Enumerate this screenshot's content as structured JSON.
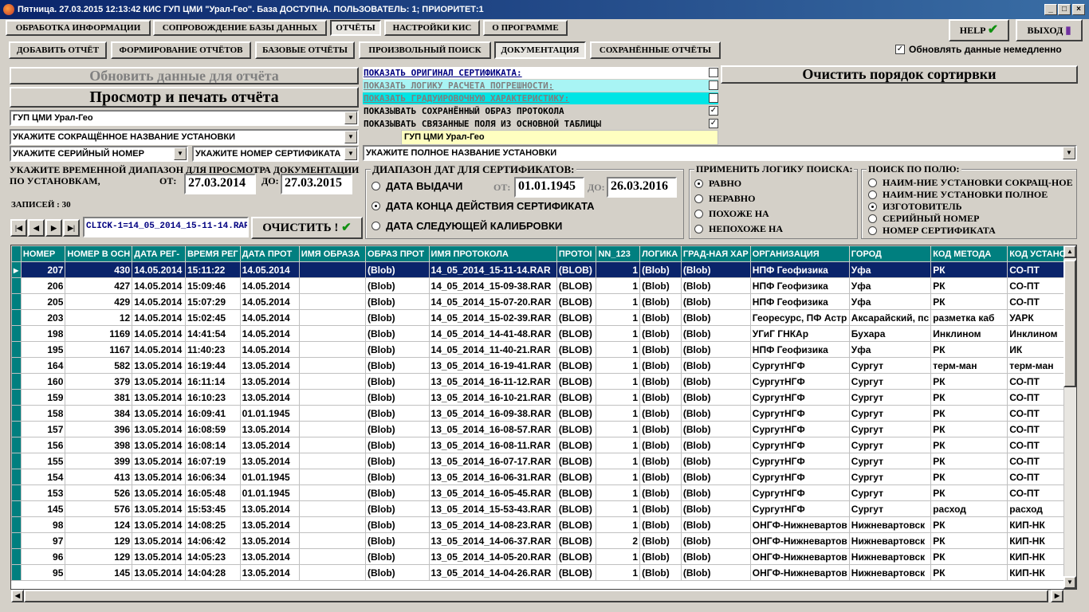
{
  "window": {
    "title": "Пятница. 27.03.2015 12:13:42 КИС ГУП ЦМИ \"Урал-Гео\". База ДОСТУПНА. ПОЛЬЗОВАТЕЛЬ: 1; ПРИОРИТЕТ:1"
  },
  "main_tabs": [
    "ОБРАБОТКА ИНФОРМАЦИИ",
    "СОПРОВОЖДЕНИЕ БАЗЫ ДАННЫХ",
    "ОТЧЁТЫ",
    "НАСТРОЙКИ КИС",
    "О ПРОГРАММЕ"
  ],
  "sub_tabs": [
    "ДОБАВИТЬ ОТЧЁТ",
    "ФОРМИРОВАНИЕ ОТЧЁТОВ",
    "БАЗОВЫЕ ОТЧЁТЫ",
    "ПРОИЗВОЛЬНЫЙ ПОИСК",
    "ДОКУМЕНТАЦИЯ",
    "СОХРАНЁННЫЕ ОТЧЁТЫ"
  ],
  "help_label": "HELP",
  "exit_label": "ВЫХОД",
  "auto_update": {
    "label": "Обновлять данные немедленно",
    "checked": true
  },
  "refresh_btn": "Обновить данные для отчёта",
  "print_btn": "Просмотр и печать отчёта",
  "clear_sort_btn": "Очистить порядок сортирвки",
  "org_combo": "ГУП ЦМИ Урал-Гео",
  "short_name_combo": "УКАЖИТЕ СОКРАЩЁННОЕ НАЗВАНИЕ УСТАНОВКИ",
  "serial_combo": "УКАЖИТЕ СЕРИЙНЫЙ НОМЕР",
  "cert_combo": "УКАЖИТЕ НОМЕР СЕРТИФИКАТА",
  "full_name_combo": "УКАЖИТЕ ПОЛНОЕ НАЗВАНИЕ УСТАНОВКИ",
  "org_display": "ГУП ЦМИ Урал-Гео",
  "options": [
    {
      "label": "ПОКАЗАТЬ ОРИГИНАЛ СЕРТИФИКАТА:",
      "checked": false,
      "bg": "#ffffff",
      "color": "#000080"
    },
    {
      "label": "ПОКАЗАТЬ ЛОГИКУ РАСЧЕТА ПОГРЕШНОСТИ:",
      "checked": false,
      "bg": "#a8f4f4",
      "color": "#7f7f7f"
    },
    {
      "label": "ПОКАЗАТЬ ГРАДУИРОВОЧНУЮ ХАРАКТЕРИСТИКУ:",
      "checked": false,
      "bg": "#00e5e5",
      "color": "#7f7f7f"
    },
    {
      "label": "ПОКАЗЫВАТЬ СОХРАНЁННЫЙ ОБРАЗ ПРОТОКОЛА",
      "checked": true,
      "bg": "#d4d0c8",
      "color": "#000000"
    },
    {
      "label": "ПОКАЗЫВАТЬ СВЯЗАННЫЕ ПОЛЯ ИЗ ОСНОВНОЙ ТАБЛИЦЫ",
      "checked": true,
      "bg": "#d4d0c8",
      "color": "#000000"
    }
  ],
  "range_label_1": "УКАЖИТЕ ВРЕМЕННОЙ ДИАПАЗОН ДЛЯ ПРОСМОТРА ДОКУМЕНТАЦИИ",
  "range_label_2": "ПО УСТАНОВКАМ,",
  "from_label": "ОТ:",
  "to_label": "ДО:",
  "date_from": "27.03.2014",
  "date_to": "27.03.2015",
  "records_label": "ЗАПИСЕЙ : 30",
  "filter_text": "CLICK-1=14_05_2014_15-11-14.RAR",
  "clear_btn": "ОЧИСТИТЬ !",
  "cert_range": {
    "title": "ДИАПАЗОН ДАТ ДЛЯ СЕРТИФИКАТОВ:",
    "options": [
      "ДАТА ВЫДАЧИ",
      "ДАТА КОНЦА ДЕЙСТВИЯ СЕРТИФИКАТА",
      "ДАТА СЛЕДУЮЩЕЙ КАЛИБРОВКИ"
    ],
    "selected": 1,
    "from_label": "ОТ:",
    "to_label": "ДО:",
    "from": "01.01.1945",
    "to": "26.03.2016"
  },
  "logic": {
    "title": "ПРИМЕНИТЬ ЛОГИКУ ПОИСКА:",
    "options": [
      "РАВНО",
      "НЕРАВНО",
      "ПОХОЖЕ НА",
      "НЕПОХОЖЕ НА"
    ],
    "selected": 0
  },
  "field": {
    "title": "ПОИСК ПО ПОЛЮ:",
    "options": [
      "НАИМ-НИЕ УСТАНОВКИ СОКРАЩ-НОЕ",
      "НАИМ-НИЕ УСТАНОВКИ ПОЛНОЕ",
      "ИЗГОТОВИТЕЛЬ",
      "СЕРИЙНЫЙ НОМЕР",
      "НОМЕР СЕРТИФИКАТА"
    ],
    "selected": 2
  },
  "nav_icons": [
    "first-record-icon",
    "prev-record-icon",
    "next-record-icon",
    "last-record-icon"
  ],
  "table": {
    "headers": [
      "НОМЕР",
      "НОМЕР В ОСН",
      "ДАТА РЕГ-",
      "ВРЕМЯ РЕГ",
      "ДАТА ПРОТ",
      "ИМЯ ОБРАЗА",
      "ОБРАЗ ПРОТ",
      "ИМЯ ПРОТОКОЛА",
      "ПРОТОІ",
      "NN_123",
      "ЛОГИКА",
      "ГРАД-НАЯ ХАР",
      "ОРГАНИЗАЦИЯ",
      "ГОРОД",
      "КОД МЕТОДА",
      "КОД УСТАНОВ"
    ],
    "rows": [
      [
        "207",
        "430",
        "14.05.2014",
        "15:11:22",
        "14.05.2014",
        "",
        "(Blob)",
        "14_05_2014_15-11-14.RAR",
        "(BLOB)",
        "1",
        "(Blob)",
        "(Blob)",
        "НПФ Геофизика",
        "Уфа",
        "РК",
        "СО-ПТ"
      ],
      [
        "206",
        "427",
        "14.05.2014",
        "15:09:46",
        "14.05.2014",
        "",
        "(Blob)",
        "14_05_2014_15-09-38.RAR",
        "(BLOB)",
        "1",
        "(Blob)",
        "(Blob)",
        "НПФ Геофизика",
        "Уфа",
        "РК",
        "СО-ПТ"
      ],
      [
        "205",
        "429",
        "14.05.2014",
        "15:07:29",
        "14.05.2014",
        "",
        "(Blob)",
        "14_05_2014_15-07-20.RAR",
        "(BLOB)",
        "1",
        "(Blob)",
        "(Blob)",
        "НПФ Геофизика",
        "Уфа",
        "РК",
        "СО-ПТ"
      ],
      [
        "203",
        "12",
        "14.05.2014",
        "15:02:45",
        "14.05.2014",
        "",
        "(Blob)",
        "14_05_2014_15-02-39.RAR",
        "(BLOB)",
        "1",
        "(Blob)",
        "(Blob)",
        "Георесурс, ПФ Астр",
        "Аксарайский, пс",
        "разметка каб",
        "УАРК"
      ],
      [
        "198",
        "1169",
        "14.05.2014",
        "14:41:54",
        "14.05.2014",
        "",
        "(Blob)",
        "14_05_2014_14-41-48.RAR",
        "(BLOB)",
        "1",
        "(Blob)",
        "(Blob)",
        "УГиГ ГНКАр",
        "Бухара",
        "Инклином",
        "Инклином"
      ],
      [
        "195",
        "1167",
        "14.05.2014",
        "11:40:23",
        "14.05.2014",
        "",
        "(Blob)",
        "14_05_2014_11-40-21.RAR",
        "(BLOB)",
        "1",
        "(Blob)",
        "(Blob)",
        "НПФ Геофизика",
        "Уфа",
        "РК",
        "ИК"
      ],
      [
        "164",
        "582",
        "13.05.2014",
        "16:19:44",
        "13.05.2014",
        "",
        "(Blob)",
        "13_05_2014_16-19-41.RAR",
        "(BLOB)",
        "1",
        "(Blob)",
        "(Blob)",
        "СургутНГФ",
        "Сургут",
        "терм-ман",
        "терм-ман"
      ],
      [
        "160",
        "379",
        "13.05.2014",
        "16:11:14",
        "13.05.2014",
        "",
        "(Blob)",
        "13_05_2014_16-11-12.RAR",
        "(BLOB)",
        "1",
        "(Blob)",
        "(Blob)",
        "СургутНГФ",
        "Сургут",
        "РК",
        "СО-ПТ"
      ],
      [
        "159",
        "381",
        "13.05.2014",
        "16:10:23",
        "13.05.2014",
        "",
        "(Blob)",
        "13_05_2014_16-10-21.RAR",
        "(BLOB)",
        "1",
        "(Blob)",
        "(Blob)",
        "СургутНГФ",
        "Сургут",
        "РК",
        "СО-ПТ"
      ],
      [
        "158",
        "384",
        "13.05.2014",
        "16:09:41",
        "01.01.1945",
        "",
        "(Blob)",
        "13_05_2014_16-09-38.RAR",
        "(BLOB)",
        "1",
        "(Blob)",
        "(Blob)",
        "СургутНГФ",
        "Сургут",
        "РК",
        "СО-ПТ"
      ],
      [
        "157",
        "396",
        "13.05.2014",
        "16:08:59",
        "13.05.2014",
        "",
        "(Blob)",
        "13_05_2014_16-08-57.RAR",
        "(BLOB)",
        "1",
        "(Blob)",
        "(Blob)",
        "СургутНГФ",
        "Сургут",
        "РК",
        "СО-ПТ"
      ],
      [
        "156",
        "398",
        "13.05.2014",
        "16:08:14",
        "13.05.2014",
        "",
        "(Blob)",
        "13_05_2014_16-08-11.RAR",
        "(BLOB)",
        "1",
        "(Blob)",
        "(Blob)",
        "СургутНГФ",
        "Сургут",
        "РК",
        "СО-ПТ"
      ],
      [
        "155",
        "399",
        "13.05.2014",
        "16:07:19",
        "13.05.2014",
        "",
        "(Blob)",
        "13_05_2014_16-07-17.RAR",
        "(BLOB)",
        "1",
        "(Blob)",
        "(Blob)",
        "СургутНГФ",
        "Сургут",
        "РК",
        "СО-ПТ"
      ],
      [
        "154",
        "413",
        "13.05.2014",
        "16:06:34",
        "01.01.1945",
        "",
        "(Blob)",
        "13_05_2014_16-06-31.RAR",
        "(BLOB)",
        "1",
        "(Blob)",
        "(Blob)",
        "СургутНГФ",
        "Сургут",
        "РК",
        "СО-ПТ"
      ],
      [
        "153",
        "526",
        "13.05.2014",
        "16:05:48",
        "01.01.1945",
        "",
        "(Blob)",
        "13_05_2014_16-05-45.RAR",
        "(BLOB)",
        "1",
        "(Blob)",
        "(Blob)",
        "СургутНГФ",
        "Сургут",
        "РК",
        "СО-ПТ"
      ],
      [
        "145",
        "576",
        "13.05.2014",
        "15:53:45",
        "13.05.2014",
        "",
        "(Blob)",
        "13_05_2014_15-53-43.RAR",
        "(BLOB)",
        "1",
        "(Blob)",
        "(Blob)",
        "СургутНГФ",
        "Сургут",
        "расход",
        "расход"
      ],
      [
        "98",
        "124",
        "13.05.2014",
        "14:08:25",
        "13.05.2014",
        "",
        "(Blob)",
        "13_05_2014_14-08-23.RAR",
        "(BLOB)",
        "1",
        "(Blob)",
        "(Blob)",
        "ОНГФ-Нижневартов",
        "Нижневартовск",
        "РК",
        "КИП-НК"
      ],
      [
        "97",
        "129",
        "13.05.2014",
        "14:06:42",
        "13.05.2014",
        "",
        "(Blob)",
        "13_05_2014_14-06-37.RAR",
        "(BLOB)",
        "2",
        "(Blob)",
        "(Blob)",
        "ОНГФ-Нижневартов",
        "Нижневартовск",
        "РК",
        "КИП-НК"
      ],
      [
        "96",
        "129",
        "13.05.2014",
        "14:05:23",
        "13.05.2014",
        "",
        "(Blob)",
        "13_05_2014_14-05-20.RAR",
        "(BLOB)",
        "1",
        "(Blob)",
        "(Blob)",
        "ОНГФ-Нижневартов",
        "Нижневартовск",
        "РК",
        "КИП-НК"
      ],
      [
        "95",
        "145",
        "13.05.2014",
        "14:04:28",
        "13.05.2014",
        "",
        "(Blob)",
        "13_05_2014_14-04-26.RAR",
        "(BLOB)",
        "1",
        "(Blob)",
        "(Blob)",
        "ОНГФ-Нижневартов",
        "Нижневартовск",
        "РК",
        "КИП-НК"
      ]
    ]
  }
}
